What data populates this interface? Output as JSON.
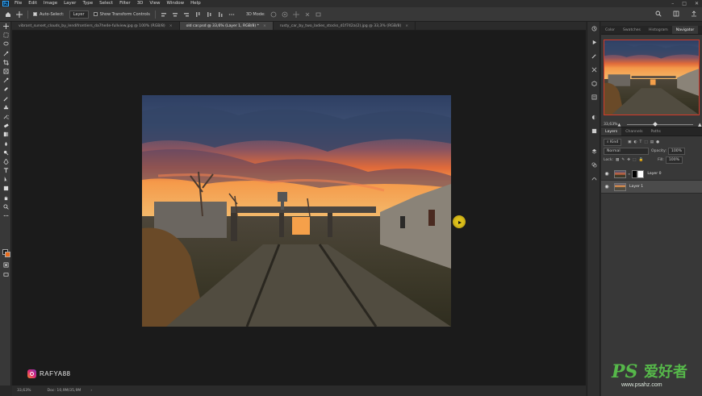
{
  "menu": {
    "items": [
      "File",
      "Edit",
      "Image",
      "Layer",
      "Type",
      "Select",
      "Filter",
      "3D",
      "View",
      "Window",
      "Help"
    ]
  },
  "options_bar": {
    "auto_select_label": "Auto-Select:",
    "auto_select_checked": true,
    "auto_select_target": "Layer",
    "transform_controls_label": "Show Transform Controls",
    "transform_controls_checked": false,
    "mode_label": "3D Mode:"
  },
  "tabs": [
    {
      "label": "vibrant_sunset_clouds_by_lendifrontiers_da7he4e-fullview.jpg @ 100% (RGB/8)",
      "active": false
    },
    {
      "label": "old car.psd @ 33,6% (Layer 1, RGB/8) *",
      "active": true
    },
    {
      "label": "rusty_car_by_two_ladies_stocks_d1f742a(2).jpg @ 33,3% (RGB/8)",
      "active": false
    }
  ],
  "workspace": {
    "watermark_handle": "RAFYA88"
  },
  "status_bar": {
    "zoom": "33,63%",
    "doc": "Doc: 10,9M/35,9M"
  },
  "panels": {
    "top_tabs": [
      "Color",
      "Swatches",
      "Histogram",
      "Navigator"
    ],
    "active_top_tab": "Navigator",
    "navigator_zoom": "33,63%",
    "layers_tabs": [
      "Layers",
      "Channels",
      "Paths"
    ],
    "active_layers_tab": "Layers",
    "kind_filter": "Kind",
    "blend_mode": "Normal",
    "opacity_label": "Opacity:",
    "opacity": "100%",
    "lock_label": "Lock:",
    "fill_label": "Fill:",
    "fill": "100%",
    "layers": [
      {
        "name": "Layer 0",
        "has_mask": true,
        "selected": false
      },
      {
        "name": "Layer 1",
        "has_mask": false,
        "selected": true
      }
    ]
  },
  "site_watermark": {
    "brand": "PS",
    "chinese": "爱好者",
    "url": "www.psahz.com"
  },
  "colors": {
    "foreground": "#0f0f0f",
    "background": "#e96c1c",
    "navigator_frame": "#d43a2a",
    "watermark_green": "#56b84a"
  }
}
